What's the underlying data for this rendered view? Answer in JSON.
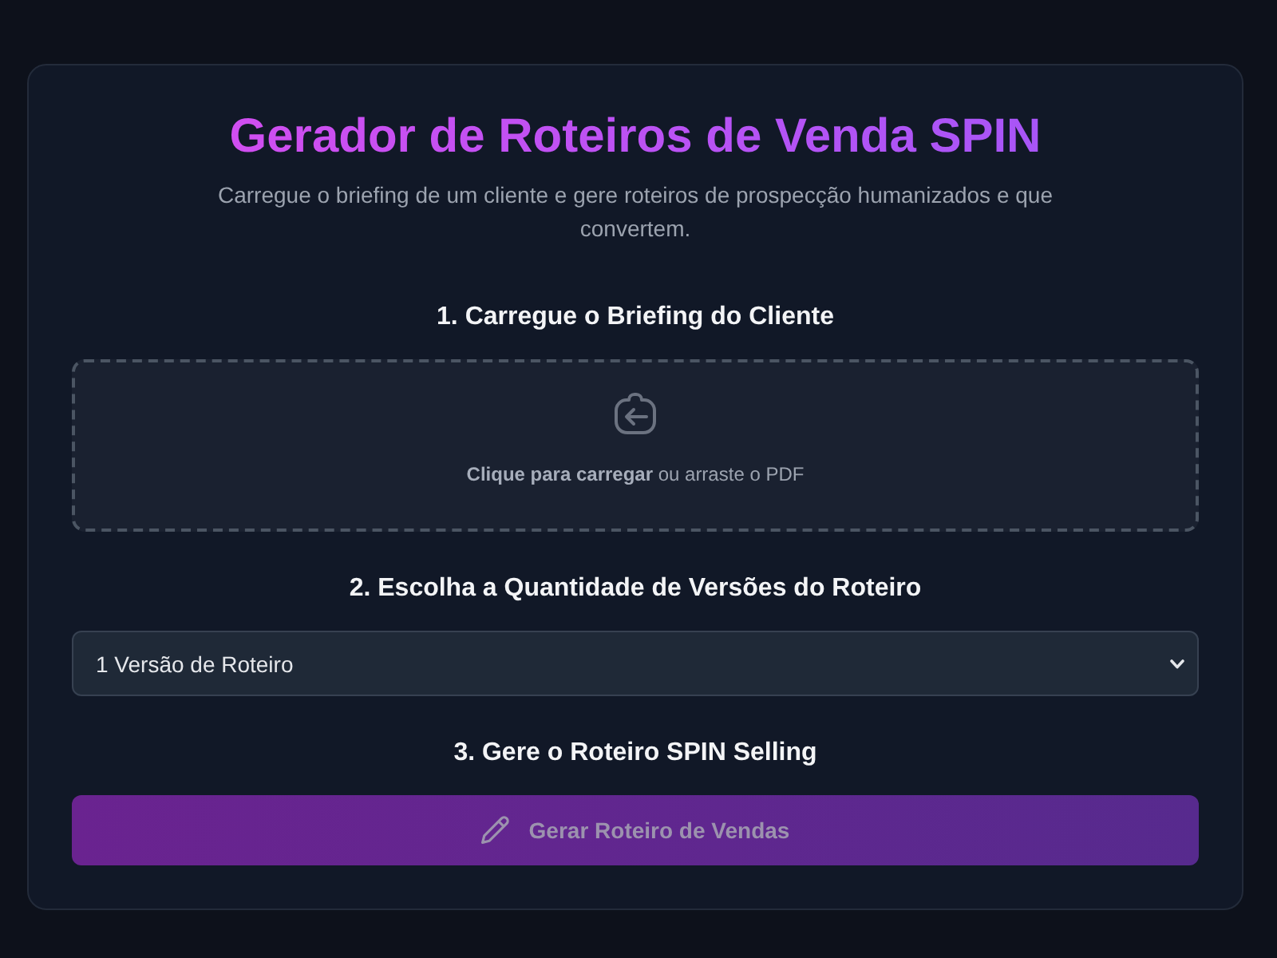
{
  "header": {
    "title": "Gerador de Roteiros de Venda SPIN",
    "subtitle": "Carregue o briefing de um cliente e gere roteiros de prospecção humanizados e que convertem."
  },
  "steps": [
    {
      "kind": "upload",
      "heading": "1. Carregue o Briefing do Cliente",
      "prompt": "**Clique para carregar** ou arraste o PDF"
    },
    {
      "kind": "select",
      "heading": "2. Escolha a Quantidade de Versões do Roteiro",
      "value": "1 Versão de Roteiro"
    },
    {
      "kind": "action",
      "heading": "3. Gere o Roteiro SPIN Selling",
      "button": {
        "label": "Gerar Roteiro de Vendas",
        "disabled": true
      }
    }
  ]
}
